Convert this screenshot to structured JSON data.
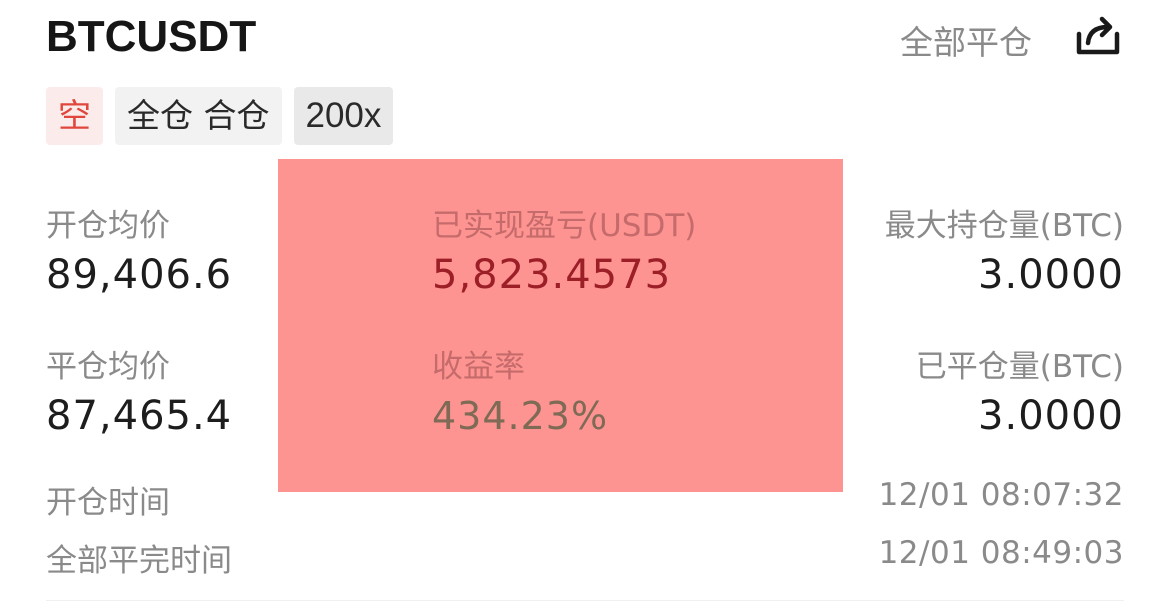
{
  "header": {
    "symbol": "BTCUSDT",
    "close_all_label": "全部平仓"
  },
  "tags": {
    "side": "空",
    "margin_mode": "全仓 合仓",
    "leverage": "200x"
  },
  "stats": {
    "open_avg_price_label": "开仓均价",
    "open_avg_price": "89,406.6",
    "close_avg_price_label": "平仓均价",
    "close_avg_price": "87,465.4",
    "realized_pnl_label": "已实现盈亏(USDT)",
    "realized_pnl": "5,823.4573",
    "roi_label": "收益率",
    "roi": "434.23%",
    "max_position_label": "最大持仓量(BTC)",
    "max_position": "3.0000",
    "closed_amount_label": "已平仓量(BTC)",
    "closed_amount": "3.0000"
  },
  "times": {
    "open_time_label": "开仓时间",
    "open_time": "12/01 08:07:32",
    "close_time_label": "全部平完时间",
    "close_time": "12/01 08:49:03"
  },
  "icons": {
    "share": "share-icon"
  },
  "colors": {
    "short_red": "#e0463c",
    "overlay": "#fe9492",
    "pnl_red": "#9c1f28"
  }
}
